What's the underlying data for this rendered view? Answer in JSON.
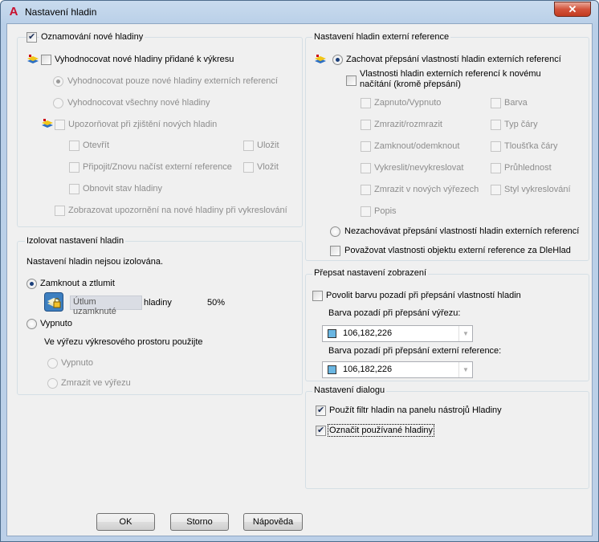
{
  "window": {
    "title": "Nastavení hladin",
    "close_icon": "close-icon",
    "app_icon": "autocad-a-icon",
    "accent": "#c8102e"
  },
  "new_layers": {
    "title": "Oznamování nové hladiny",
    "evaluate_label": "Vyhodnocovat nové hladiny přidané k výkresu",
    "eval_xref_only": "Vyhodnocovat pouze nové hladiny externích referencí",
    "eval_all": "Vyhodnocovat všechny nové hladiny",
    "notify_label": "Upozorňovat při zjištění nových hladin",
    "open": "Otevřít",
    "save": "Uložit",
    "attach_reload": "Připojit/Znovu načíst externí reference",
    "insert": "Vložit",
    "restore_state": "Obnovit stav hladiny",
    "display_warning": "Zobrazovat upozornění na nové hladiny při vykreslování"
  },
  "isolate": {
    "title": "Izolovat nastavení hladin",
    "status": "Nastavení hladin nejsou izolována.",
    "lock_fade": "Zamknout a ztlumit",
    "fade_field": "Útlum uzamknuté",
    "fade_suffix": "hladiny",
    "fade_value": "50%",
    "off": "Vypnuto",
    "viewport_label": "Ve výřezu výkresového prostoru použijte",
    "vp_off": "Vypnuto",
    "vp_freeze": "Zmrazit ve výřezu"
  },
  "xref": {
    "title": "Nastavení hladin externí reference",
    "retain": "Zachovat přepsání vlastností hladin externích referencí",
    "reload_props_line1": "Vlastnosti hladin externích referencí k novému",
    "reload_props_line2": "načítání (kromě přepsání)",
    "on_off": "Zapnuto/Vypnuto",
    "color": "Barva",
    "freeze": "Zmrazit/rozmrazit",
    "linetype": "Typ čáry",
    "lock": "Zamknout/odemknout",
    "lineweight": "Tloušťka čáry",
    "plot": "Vykreslit/nevykreslovat",
    "transparency": "Průhlednost",
    "vp_freeze": "Zmrazit v nových výřezech",
    "plot_style": "Styl vykreslování",
    "description": "Popis",
    "dont_retain": "Nezachovávat přepsání vlastností hladin externích referencí",
    "treat_bylayer": "Považovat vlastnosti objektu externí reference za DleHlad"
  },
  "display": {
    "title": "Přepsat nastavení zobrazení",
    "bg_color_label": "Povolit barvu pozadí při přepsání vlastností hladin",
    "vp_bg_label": "Barva pozadí při přepsání výřezu:",
    "vp_bg_value": "106,182,226",
    "xref_bg_label": "Barva pozadí při přepsání externí reference:",
    "xref_bg_value": "106,182,226",
    "swatch_color": "#6ab6e2"
  },
  "dialog": {
    "title": "Nastavení dialogu",
    "filter": "Použít filtr hladin na panelu nástrojů Hladiny",
    "mark_used": "Označit používané hladiny"
  },
  "buttons": {
    "ok": "OK",
    "cancel": "Storno",
    "help": "Nápověda"
  }
}
